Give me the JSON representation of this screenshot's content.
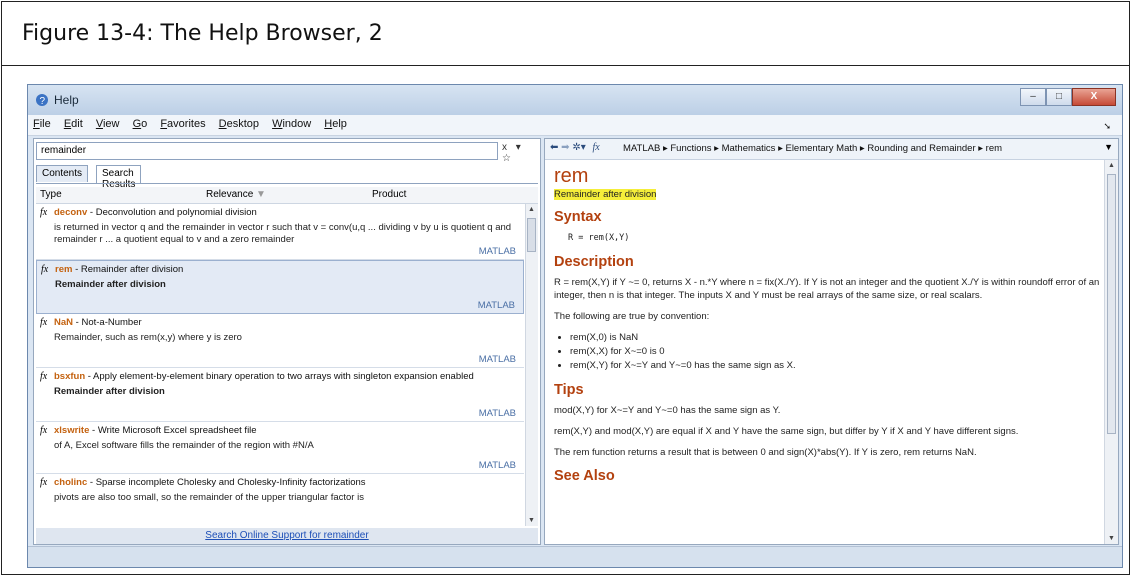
{
  "caption": "Figure 13-4: The Help Browser, 2",
  "window": {
    "title": "Help",
    "controls": {
      "minimize": "–",
      "maximize": "□",
      "close": "X"
    }
  },
  "menu": [
    "File",
    "Edit",
    "View",
    "Go",
    "Favorites",
    "Desktop",
    "Window",
    "Help"
  ],
  "search": {
    "value": "remainder",
    "clear": "x",
    "dropdown": "▾",
    "star": "☆"
  },
  "tabs": {
    "contents": "Contents",
    "search_results": "Search Results"
  },
  "columns": {
    "type": "Type",
    "relevance": "Relevance",
    "product": "Product"
  },
  "results": [
    {
      "name": "deconv",
      "summary": " - Deconvolution and polynomial division",
      "desc": "is returned in vector q and the remainder in vector r such that v = conv(u,q ... dividing v by u is quotient q and remainder r ... a quotient equal to v and a zero remainder",
      "product": "MATLAB"
    },
    {
      "name": "rem",
      "summary": " - Remainder after division",
      "desc": "Remainder after division",
      "product": "MATLAB"
    },
    {
      "name": "NaN",
      "summary": " - Not-a-Number",
      "desc": "Remainder, such as rem(x,y) where y is zero",
      "product": "MATLAB"
    },
    {
      "name": "bsxfun",
      "summary": " - Apply element-by-element binary operation to two arrays with singleton expansion enabled",
      "desc": "Remainder after division",
      "product": "MATLAB"
    },
    {
      "name": "xlswrite",
      "summary": " - Write Microsoft Excel spreadsheet file",
      "desc": "of A, Excel software fills the remainder of the region with #N/A",
      "product": "MATLAB"
    },
    {
      "name": "cholinc",
      "summary": " - Sparse incomplete Cholesky and Cholesky-Infinity factorizations",
      "desc": "pivots are also too small, so the remainder of the upper triangular factor is",
      "product": ""
    }
  ],
  "online_link": "Search Online Support for remainder",
  "breadcrumb": "MATLAB ▸ Functions ▸ Mathematics ▸ Elementary Math ▸ Rounding and Remainder ▸ rem",
  "doc": {
    "title": "rem",
    "purpose": "Remainder",
    "purpose_rest": " after division",
    "syntax_h": "Syntax",
    "syntax": "R = rem(X,Y)",
    "desc_h": "Description",
    "desc1": "R = rem(X,Y) if Y ~= 0, returns X - n.*Y where n = fix(X./Y). If Y is not an integer and the quotient X./Y is within roundoff error of an integer, then n is that integer. The inputs X and Y must be real arrays of the same size, or real scalars.",
    "desc2": "The following are true by convention:",
    "bullets": [
      "rem(X,0) is NaN",
      "rem(X,X) for X~=0 is 0",
      "rem(X,Y) for X~=Y and Y~=0 has the same sign as X."
    ],
    "tips_h": "Tips",
    "tip1": "mod(X,Y) for X~=Y and Y~=0 has the same sign as Y.",
    "tip2": "rem(X,Y) and mod(X,Y) are equal if X and Y have the same sign, but differ by Y if X and Y have different signs.",
    "tip3": "The rem function returns a result that is between 0 and sign(X)*abs(Y). If Y is zero, rem returns NaN.",
    "seealso_h": "See Also"
  },
  "colors": {
    "accent": "#b3410f",
    "link": "#1d4fb7",
    "highlight": "#f5ee3a"
  }
}
